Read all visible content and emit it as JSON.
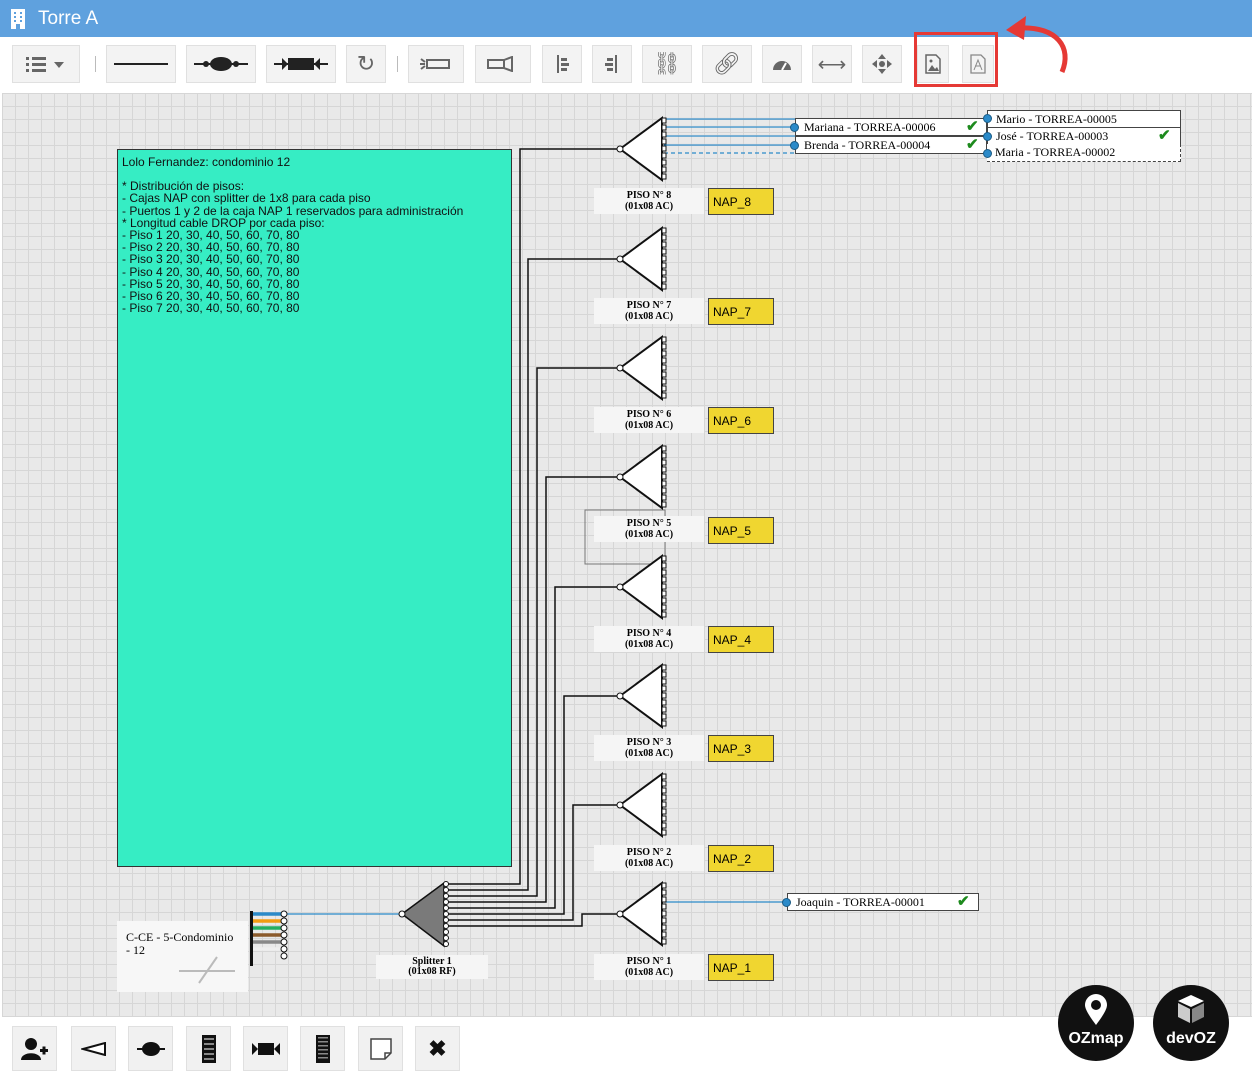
{
  "window": {
    "title": "Torre A",
    "icon": "building-icon"
  },
  "toolbar": {
    "buttons": [
      {
        "name": "list-menu-button",
        "icon": "list-icon"
      },
      {
        "name": "line-tool-button",
        "icon": "line-icon"
      },
      {
        "name": "fusion-tool-button",
        "icon": "fusion-icon"
      },
      {
        "name": "connector-tool-button",
        "icon": "connector-icon"
      },
      {
        "name": "refresh-button",
        "icon": "refresh-icon"
      },
      {
        "name": "light-source-button",
        "icon": "light-source-icon"
      },
      {
        "name": "power-meter-button",
        "icon": "power-meter-icon"
      },
      {
        "name": "align-left-button",
        "icon": "align-icon"
      },
      {
        "name": "align-right-button",
        "icon": "align-icon"
      },
      {
        "name": "disconnect-button",
        "icon": "unlink-icon"
      },
      {
        "name": "reconnect-button",
        "icon": "link-icon"
      },
      {
        "name": "speed-button",
        "icon": "gauge-icon"
      },
      {
        "name": "resize-button",
        "icon": "arrows-horizontal-icon"
      },
      {
        "name": "move-button",
        "icon": "move-icon"
      },
      {
        "name": "export-image-button",
        "icon": "image-file-icon"
      },
      {
        "name": "export-pdf-button",
        "icon": "pdf-file-icon"
      }
    ],
    "highlight_color": "#e53935"
  },
  "note": {
    "title": "Lolo Fernandez: condominio 12",
    "lines": [
      "* Distribución de pisos:",
      "- Cajas NAP con splitter de 1x8 para cada piso",
      "- Puertos 1 y 2 de la caja NAP 1 reservados para administración",
      "* Longitud cable DROP por cada piso:",
      "- Piso 1 20, 30, 40, 50, 60, 70, 80",
      "- Piso 2 20, 30, 40, 50, 60, 70, 80",
      "- Piso 3 20, 30, 40, 50, 60, 70, 80",
      "- Piso 4 20, 30, 40, 50, 60, 70, 80",
      "- Piso 5 20, 30, 40, 50, 60, 70, 80",
      "- Piso 6 20, 30, 40, 50, 60, 70, 80",
      "- Piso 7 20, 30, 40, 50, 60, 70, 80"
    ],
    "color": "#36edc4"
  },
  "floors": [
    {
      "label": "PISO N° 8",
      "sub": "(01x08 AC)",
      "nap": "NAP_8"
    },
    {
      "label": "PISO N° 7",
      "sub": "(01x08 AC)",
      "nap": "NAP_7"
    },
    {
      "label": "PISO N° 6",
      "sub": "(01x08 AC)",
      "nap": "NAP_6"
    },
    {
      "label": "PISO N° 5",
      "sub": "(01x08 AC)",
      "nap": "NAP_5"
    },
    {
      "label": "PISO N° 4",
      "sub": "(01x08 AC)",
      "nap": "NAP_4"
    },
    {
      "label": "PISO N° 3",
      "sub": "(01x08 AC)",
      "nap": "NAP_3"
    },
    {
      "label": "PISO N° 2",
      "sub": "(01x08 AC)",
      "nap": "NAP_2"
    },
    {
      "label": "PISO N° 1",
      "sub": "(01x08 AC)",
      "nap": "NAP_1"
    }
  ],
  "clients": [
    {
      "name": "Mario - TORREA-00005",
      "checked": false
    },
    {
      "name": "Mariana - TORREA-00006",
      "checked": true
    },
    {
      "name": "José - TORREA-00003",
      "checked": true
    },
    {
      "name": "Brenda - TORREA-00004",
      "checked": true
    },
    {
      "name": "Maria - TORREA-00002",
      "checked": false
    },
    {
      "name": "Joaquin - TORREA-00001",
      "checked": true
    }
  ],
  "cable": {
    "label": "C-CE - 5-Condominio - 12"
  },
  "splitter": {
    "label": "Splitter 1",
    "sub": "(01x08 RF)"
  },
  "bottom_tools": [
    {
      "name": "add-client-button",
      "icon": "add-user-icon"
    },
    {
      "name": "add-splitter-button",
      "icon": "splitter-icon"
    },
    {
      "name": "add-fusion-button",
      "icon": "fusion-icon"
    },
    {
      "name": "add-dio-button",
      "icon": "dio-icon"
    },
    {
      "name": "add-connector-button",
      "icon": "connector-icon"
    },
    {
      "name": "add-switch-button",
      "icon": "switch-icon"
    },
    {
      "name": "add-note-button",
      "icon": "note-icon"
    },
    {
      "name": "delete-button",
      "icon": "close-icon"
    }
  ],
  "logos": [
    {
      "text": "OZmap",
      "icon": "map-pin-icon"
    },
    {
      "text": "devOZ",
      "icon": "box-icon"
    }
  ]
}
